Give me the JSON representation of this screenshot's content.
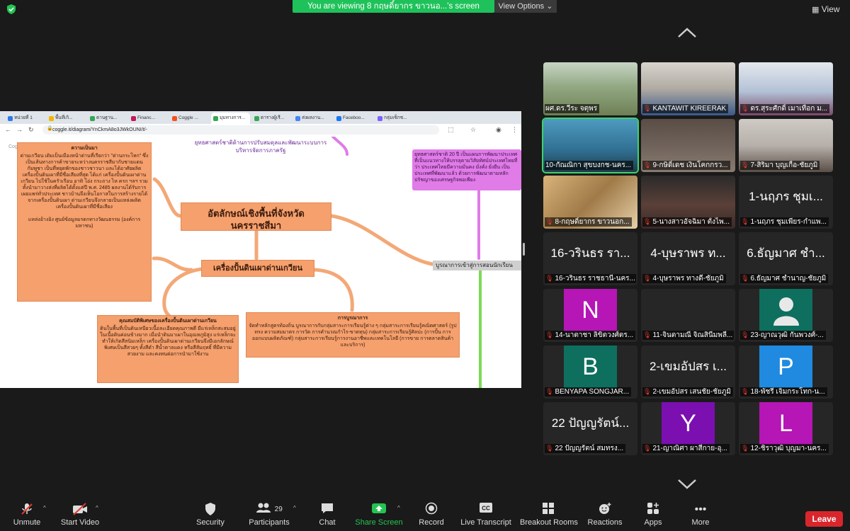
{
  "top": {
    "banner": "You are viewing 8 กฤษดิ์ยากร ขาวนอ...'s screen",
    "view_options": "View Options ⌄",
    "view": "View"
  },
  "browser": {
    "tabs": [
      "หน่วยที่ 1",
      "พื้นที่เกิ...",
      "ดานฐาน...",
      "Financ...",
      "Coggle ...",
      "มุมทางการ...",
      "ตารางผู้เรี...",
      "ส่งผลงาน...",
      "Faceboo...",
      "กลุ่มเซ็กช..."
    ],
    "url": "coggle.it/diagram/YnCkmA8o3JWkOUNI/t/-",
    "back_label": "Coggle"
  },
  "mindmap": {
    "central": "อัตลักษณ์เชิงพื้นที่จังหวัดนครราชสีมา",
    "sub": "เครื่องปั้นดินเผาด่านเกวียน",
    "background_heading": "ความเป็นมา",
    "background_text": "ด่านเกวียน เดิมเป็นเมืองหน้าด่านที่เรียกว่า \"ด่านกระโทก\" ซึ่งเป็นเส้นทางการค้าขายระหว่างนครราชสีมากับชายแดนกัมพูชา เป็นที่หยุดพักของชาวชาวนา และได้อาศัยผลิตเครื่องปั้นดินเผาที่มีชื่อเสียงที่สุด ได้แก่ เครื่องปั้นดินเผาด่านเกวียน ไปใช้ในครัวเรือน อาทิ โอ่ง กระถาง ไห ครก ฯลฯ รวมทั้งนำมาวางส่งที่ผลิตได้ตั้งแต่ปี พ.ศ. 2485 ผลงานได้รับการเผยแพร่ทั่วประเทศ ชาวบ้านจึงเห็นโอกาสในการสร้างรายได้จากเครื่องปั้นดินเผา ด่านเกวียนจึงกลายเป็นแหล่งผลิตเครื่องปั้นดินเผาที่มีชื่อเสียง",
    "background_note": "แหล่งอ้างอิง ศูนย์ข้อมูลมรดกทางวัฒนธรรม (องค์การมหาชน)",
    "features_heading": "คุณสมบัติพิเศษของเครื่องปั้นดินเผาด่านเกวียน",
    "features_text": "ดินในพื้นที่เป็นดินเหนียวเนื้อละเอียดคุณภาพดี มีแร่เหล็กสะสมอยู่ในเนื้อดินค่อนข้างมาก เมื่อนำดินมาเผาในอุณหภูมิสูง แร่เหล็กจะทำให้เกิดสีสนิมเหล็ก เครื่องปั้นดินเผาด่านเกวียนจึงมีเอกลักษณ์พิเศษเป็นสีสวยๆ ทั้งสีดำ สีน้ำตาลแดง หรือสีสัมฤทธิ์ ที่มีความสวยงาม และคงทนต่อการนำมาใช้งาน",
    "integration_heading": "การบูรณาการ",
    "integration_text": "จัดทำหลักสูตรท้องถิ่น บูรณาการกับกลุ่มสาระการเรียนรู้ต่าง ๆ กลุ่มสาระการเรียนรู้คณิตศาสตร์ (รูปทรง ความสมมาตร การวัด การคำนวณกำไร-ขาดทุน) กลุ่มสาระการเรียนรู้ศิลปะ (การปั้น การออกแบบผลิตภัณฑ์) กลุ่มสาระการเรียนรู้การงานอาชีพและเทคโนโลยี (การขาย การตลาดสินค้าและบริการ)",
    "top_purple": "ยุทธศาสตร์ชาติด้านการปรับสมดุลและพัฒนาระบบการบริหารจัดการภาครัฐ",
    "right_purple": "ยุทธศาสตร์ชาติ 20 ปี เป็นแผนการพัฒนาประเทศ ที่เป็นแนวทางให้บรรลุตามวิสัยทัศน์ประเทศไทยที่ว่า ประเทศไทยมีความมั่นคง มั่งคั่ง ยั่งยืน เป็นประเทศที่พัฒนาแล้ว ด้วยการพัฒนาตามหลักปรัชญาของเศรษฐกิจพอเพียง",
    "right_grey": "บูรณาการเข้าสู่การสอนนักเรียน",
    "help": "?"
  },
  "participants": [
    {
      "label": "ผศ.ดร.วีระ จตุพร",
      "big": "",
      "letter": "",
      "photo": "outdoor",
      "muted": false
    },
    {
      "label": "KANTAWIT KIREERAK",
      "big": "",
      "letter": "",
      "photo": "man-blue",
      "muted": true
    },
    {
      "label": "ดร.สุระศักดิ์ เมาเทือก ม...",
      "big": "",
      "letter": "",
      "photo": "man-mask",
      "muted": true
    },
    {
      "label": "10-กัณณิกา สุขบงกช-นคร...",
      "big": "",
      "letter": "",
      "photo": "woman-hall",
      "muted": false
    },
    {
      "label": "9-กษิดิ์เดช เงินโคกกรว...",
      "big": "",
      "letter": "",
      "photo": "dim",
      "muted": true
    },
    {
      "label": "7-สิริมา บุญเกื้อ-ชัยภูมิ",
      "big": "",
      "letter": "",
      "photo": "woman-room",
      "muted": true
    },
    {
      "label": "8-กฤษดิ์ยากร ขาวนอก...",
      "big": "",
      "letter": "",
      "photo": "blurry",
      "muted": true
    },
    {
      "label": "5-นางสาวอัจฉิมา ตั้งไพ...",
      "big": "",
      "letter": "",
      "photo": "woman-dark",
      "muted": true
    },
    {
      "label": "1-นฤภร ชุมเพียร-กำแพ...",
      "big": "1-นฤภร ชุมเ...",
      "letter": "",
      "photo": "",
      "muted": true
    },
    {
      "label": "16-วรินธร ราชธานี-นคร...",
      "big": "16-วรินธร รา...",
      "letter": "",
      "photo": "",
      "muted": true
    },
    {
      "label": "4-บุษราพร ทางดี-ชัยภูมิ",
      "big": "4-บุษราพร ท...",
      "letter": "",
      "photo": "",
      "muted": true
    },
    {
      "label": "6.ธัญมาศ ชำนาญ-ชัยภูมิ",
      "big": "6.ธัญมาศ ชำ...",
      "letter": "",
      "photo": "",
      "muted": true
    },
    {
      "label": "14-นาตาชา ลิขิตวงศ์ตร...",
      "big": "",
      "letter": "N",
      "photo": "letter-magenta",
      "muted": true
    },
    {
      "label": "11-จินตามณี จิณสินีมพลี...",
      "big": "",
      "letter": "",
      "photo": "",
      "muted": true
    },
    {
      "label": "23-ญาณวุฒิ กันพวงศ์-...",
      "big": "",
      "letter": "",
      "photo": "avatar-teal",
      "muted": true
    },
    {
      "label": "BENYAPA SONGJAR...",
      "big": "",
      "letter": "B",
      "photo": "letter-teal",
      "muted": true
    },
    {
      "label": "2-เขมอัปสร เสนชัย-ชัยภูมิ",
      "big": "2-เขมอัปสร เ...",
      "letter": "",
      "photo": "",
      "muted": true
    },
    {
      "label": "18-พัชรี เจิมกระโทก-น...",
      "big": "",
      "letter": "P",
      "photo": "letter-blue",
      "muted": true
    },
    {
      "label": "22 ปัญญรัตน์ สมทรง...",
      "big": "22 ปัญญรัตน์...",
      "letter": "",
      "photo": "",
      "muted": true
    },
    {
      "label": "21-ญาณิศา ผาสีกาย-อุ...",
      "big": "",
      "letter": "Y",
      "photo": "letter-purple",
      "muted": true
    },
    {
      "label": "12-ชิราวุฒิ บุญมา-นคร...",
      "big": "",
      "letter": "L",
      "photo": "letter-magenta",
      "muted": true
    }
  ],
  "toolbar": {
    "unmute": "Unmute",
    "start_video": "Start Video",
    "security": "Security",
    "participants": "Participants",
    "participants_count": "29",
    "chat": "Chat",
    "share_screen": "Share Screen",
    "record": "Record",
    "live_transcript": "Live Transcript",
    "breakout_rooms": "Breakout Rooms",
    "reactions": "Reactions",
    "apps": "Apps",
    "more": "More",
    "leave": "Leave"
  },
  "colors": {
    "accent_green": "#1fc25a",
    "leave_red": "#d9262c",
    "mindmap_orange": "#f5a06d",
    "mindmap_purple": "#e07be8",
    "mindmap_green": "#7ed957"
  }
}
